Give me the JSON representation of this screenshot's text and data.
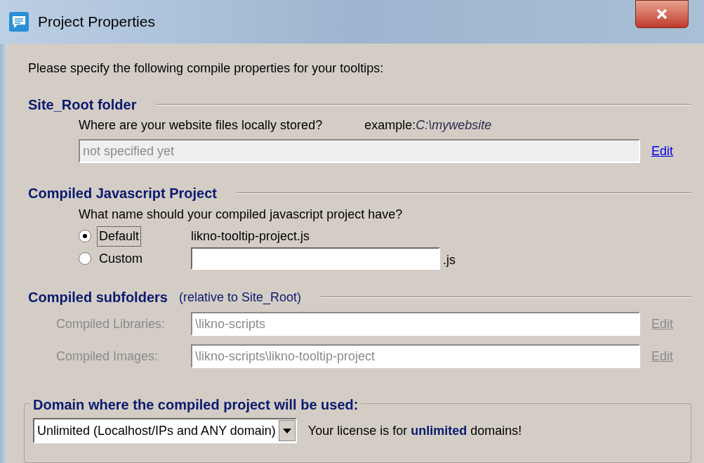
{
  "window": {
    "title": "Project Properties"
  },
  "intro": "Please specify the following compile properties for your tooltips:",
  "site_root": {
    "heading": "Site_Root folder",
    "question": "Where are your website files locally stored?",
    "example": "example:*C:\\mywebsite*",
    "field": {
      "value": "not specified yet",
      "disabled": true
    },
    "edit_link": {
      "label": "Edit",
      "disabled": false
    }
  },
  "compiled_project": {
    "heading": "Compiled Javascript Project",
    "question": "What name should your compiled javascript project have?",
    "options": [
      {
        "label": "Default",
        "selected": true,
        "kind": "text",
        "value": "likno-tooltip-project.js"
      },
      {
        "label": "Custom",
        "selected": false,
        "kind": "input",
        "suffix": ".js"
      }
    ]
  },
  "subfolders": {
    "heading": "Compiled subfolders",
    "note": "(relative to Site_Root)",
    "rows": [
      {
        "label": "Compiled Libraries:",
        "value": "\\likno-scripts",
        "disabled": true,
        "edit_label": "Edit"
      },
      {
        "label": "Compiled Images:",
        "value": "\\likno-scripts\\likno-tooltip-project",
        "disabled": true,
        "edit_label": "Edit"
      }
    ]
  },
  "domain": {
    "heading": "Domain where the compiled project will be used:",
    "dropdown": {
      "value": "Unlimited (Localhost/IPs and ANY domain)"
    },
    "license": "Your license is for **unlimited** domains!"
  }
}
